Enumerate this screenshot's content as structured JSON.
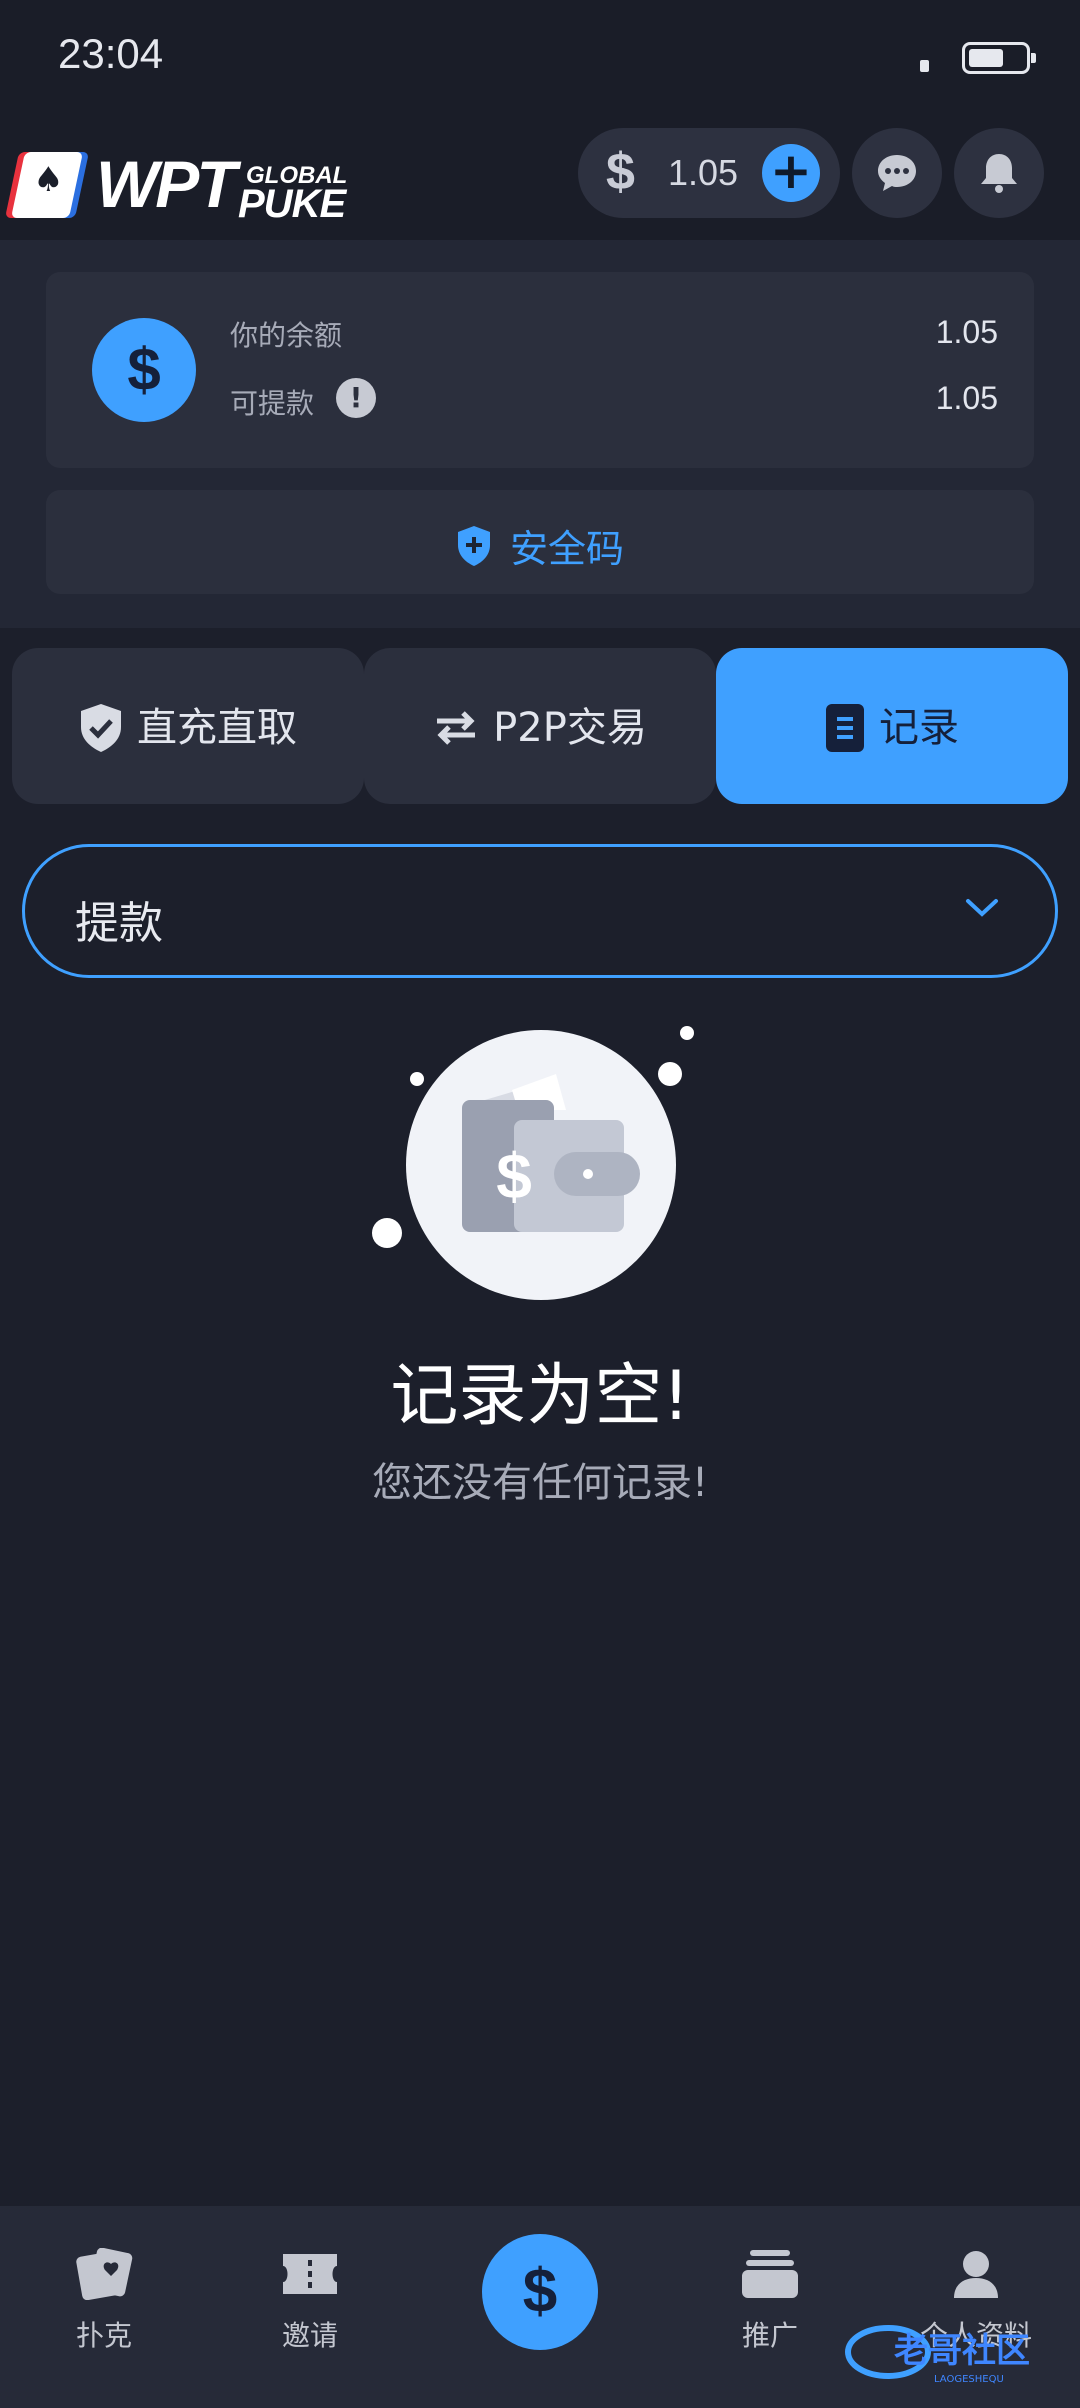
{
  "status_bar": {
    "time": "23:04"
  },
  "header": {
    "logo_main": "WPT",
    "logo_top": "GLOBAL",
    "logo_bottom": "PUKE",
    "balance_symbol": "$",
    "balance_value": "1.05",
    "add_symbol": "+"
  },
  "balance_card": {
    "coin_symbol": "$",
    "your_balance_label": "你的余额",
    "your_balance_value": "1.05",
    "withdrawable_label": "可提款",
    "withdrawable_value": "1.05",
    "info_symbol": "!"
  },
  "security_button": {
    "label": "安全码"
  },
  "tabs": [
    {
      "label": "直充直取",
      "icon": "shield-check-icon"
    },
    {
      "label": "P2P交易",
      "icon": "swap-arrows-icon"
    },
    {
      "label": "记录",
      "icon": "document-icon"
    }
  ],
  "filter": {
    "selected": "提款"
  },
  "empty_state": {
    "title": "记录为空!",
    "subtitle": "您还没有任何记录!"
  },
  "bottom_nav": {
    "items": [
      {
        "label": "扑克",
        "icon": "poker-cards-icon"
      },
      {
        "label": "邀请",
        "icon": "ticket-icon"
      },
      {
        "label": "",
        "icon": "dollar-icon",
        "center_symbol": "$"
      },
      {
        "label": "推广",
        "icon": "stack-icon"
      },
      {
        "label": "个人资料",
        "icon": "user-icon"
      }
    ]
  },
  "watermark": {
    "text": "老哥社区",
    "subtext": "LAOGESHEQU"
  },
  "colors": {
    "accent": "#3fa0ff",
    "background": "#1c1f2b",
    "card": "#2b2f3d",
    "muted_text": "#a7abb8"
  }
}
